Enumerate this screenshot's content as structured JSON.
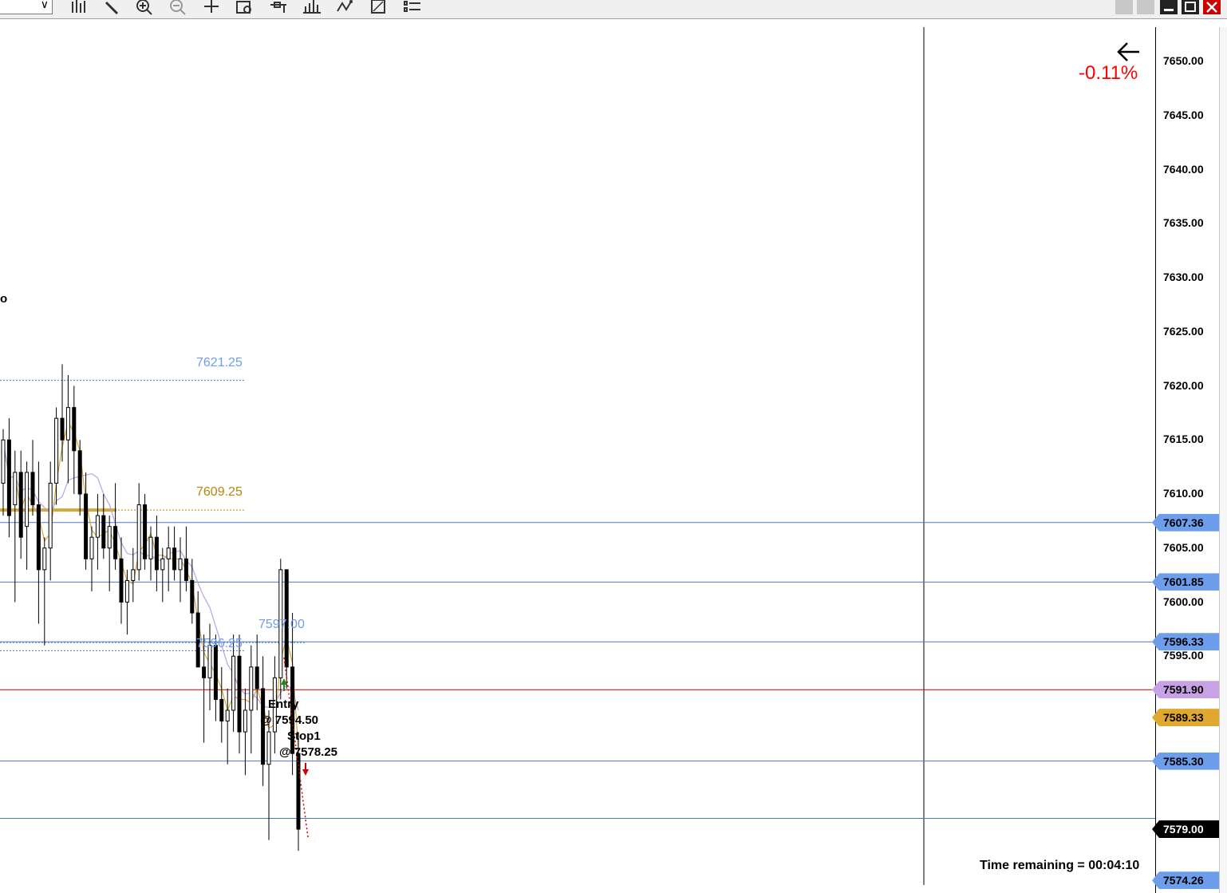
{
  "toolbar": {
    "icons": [
      "bar-style-icon",
      "draw-pencil-icon",
      "zoom-in-icon",
      "zoom-out-icon",
      "crosshair-icon",
      "data-box-icon",
      "price-marker-icon",
      "indicators-icon",
      "strategies-icon",
      "templates-icon",
      "properties-icon"
    ],
    "window_buttons": [
      "minimize-button",
      "restore-button",
      "close-button"
    ]
  },
  "axis": {
    "ticks": [
      "7650.00",
      "7645.00",
      "7640.00",
      "7635.00",
      "7630.00",
      "7625.00",
      "7620.00",
      "7615.00",
      "7610.00",
      "7605.00",
      "7600.00",
      "7595.00"
    ],
    "markers": [
      {
        "label": "7607.36",
        "price": 7607.36,
        "bg": "#6d9eeb",
        "fg": "#000000"
      },
      {
        "label": "7601.85",
        "price": 7601.85,
        "bg": "#6d9eeb",
        "fg": "#000000"
      },
      {
        "label": "7596.33",
        "price": 7596.33,
        "bg": "#6d9eeb",
        "fg": "#000000"
      },
      {
        "label": "7591.90",
        "price": 7591.9,
        "bg": "#c9a2e5",
        "fg": "#000000"
      },
      {
        "label": "7589.33",
        "price": 7589.33,
        "bg": "#e0a82e",
        "fg": "#000000"
      },
      {
        "label": "7585.30",
        "price": 7585.3,
        "bg": "#6d9eeb",
        "fg": "#000000"
      },
      {
        "label": "7579.00",
        "price": 7579.0,
        "bg": "#000000",
        "fg": "#ffffff"
      },
      {
        "label": "7574.26",
        "price": 7574.26,
        "bg": "#6d9eeb",
        "fg": "#000000"
      }
    ]
  },
  "overlay": {
    "change_pct": "-0.11%",
    "time_remaining": "Time remaining = 00:04:10",
    "left_fragment": "o"
  },
  "levels": {
    "l7621": "7621.25",
    "l7609": "7609.25",
    "l7597": "7597.00",
    "l7596": "7596.25"
  },
  "orders": {
    "entry_label": "Entry",
    "entry_price": "@ 7594.50",
    "stop_label": "Stop1",
    "stop_price": "@ 7578.25"
  },
  "colors": {
    "level_blue": "#4a78c8",
    "level_gold": "#b8860b",
    "sma_gold": "#d4a93a",
    "sma_lavender": "#b9a3e3",
    "last_price_red": "#cc0000"
  },
  "chart_data": {
    "type": "candlestick",
    "y_range": [
      7572,
      7652
    ],
    "candles": [
      [
        7611,
        7616,
        7608,
        7615
      ],
      [
        7615,
        7617,
        7606,
        7608
      ],
      [
        7609,
        7614,
        7600,
        7612
      ],
      [
        7612,
        7614,
        7604,
        7606
      ],
      [
        7607,
        7613,
        7603,
        7612
      ],
      [
        7612,
        7615,
        7608,
        7609
      ],
      [
        7609,
        7613,
        7598,
        7603
      ],
      [
        7603,
        7606,
        7596,
        7605
      ],
      [
        7605,
        7613,
        7602,
        7611
      ],
      [
        7611,
        7618,
        7609,
        7617
      ],
      [
        7617,
        7622,
        7613,
        7615
      ],
      [
        7615,
        7621,
        7611,
        7618
      ],
      [
        7618,
        7620,
        7610,
        7614
      ],
      [
        7614,
        7615,
        7608,
        7610
      ],
      [
        7610,
        7612,
        7603,
        7604
      ],
      [
        7604,
        7607,
        7601,
        7606
      ],
      [
        7606,
        7610,
        7603,
        7608
      ],
      [
        7608,
        7610,
        7604,
        7605
      ],
      [
        7605,
        7608,
        7601,
        7607
      ],
      [
        7607,
        7611,
        7603,
        7604
      ],
      [
        7604,
        7606,
        7598,
        7600
      ],
      [
        7600,
        7603,
        7597,
        7602
      ],
      [
        7602,
        7605,
        7600,
        7603
      ],
      [
        7603,
        7611,
        7602,
        7609
      ],
      [
        7609,
        7610,
        7603,
        7604
      ],
      [
        7604,
        7607,
        7602,
        7606
      ],
      [
        7606,
        7608,
        7601,
        7603
      ],
      [
        7603,
        7605,
        7600,
        7604
      ],
      [
        7604,
        7607,
        7601,
        7605
      ],
      [
        7605,
        7607,
        7602,
        7603
      ],
      [
        7603,
        7606,
        7600,
        7604
      ],
      [
        7604,
        7607,
        7601,
        7602
      ],
      [
        7602,
        7604,
        7598,
        7599
      ],
      [
        7599,
        7601,
        7596,
        7594
      ],
      [
        7594,
        7597,
        7587,
        7593
      ],
      [
        7593,
        7598,
        7590,
        7596
      ],
      [
        7596,
        7597,
        7589,
        7591
      ],
      [
        7591,
        7594,
        7587,
        7589
      ],
      [
        7589,
        7592,
        7585,
        7590
      ],
      [
        7590,
        7597,
        7588,
        7595
      ],
      [
        7595,
        7597,
        7586,
        7588
      ],
      [
        7588,
        7592,
        7584,
        7590
      ],
      [
        7590,
        7596,
        7586,
        7594
      ],
      [
        7594,
        7597,
        7590,
        7592
      ],
      [
        7592,
        7595,
        7583,
        7585
      ],
      [
        7585,
        7590,
        7578,
        7588
      ],
      [
        7588,
        7595,
        7586,
        7593
      ],
      [
        7593,
        7604,
        7591,
        7603
      ],
      [
        7603,
        7603,
        7592,
        7594
      ],
      [
        7594,
        7599,
        7584,
        7586
      ],
      [
        7586,
        7588,
        7577,
        7579
      ]
    ]
  }
}
